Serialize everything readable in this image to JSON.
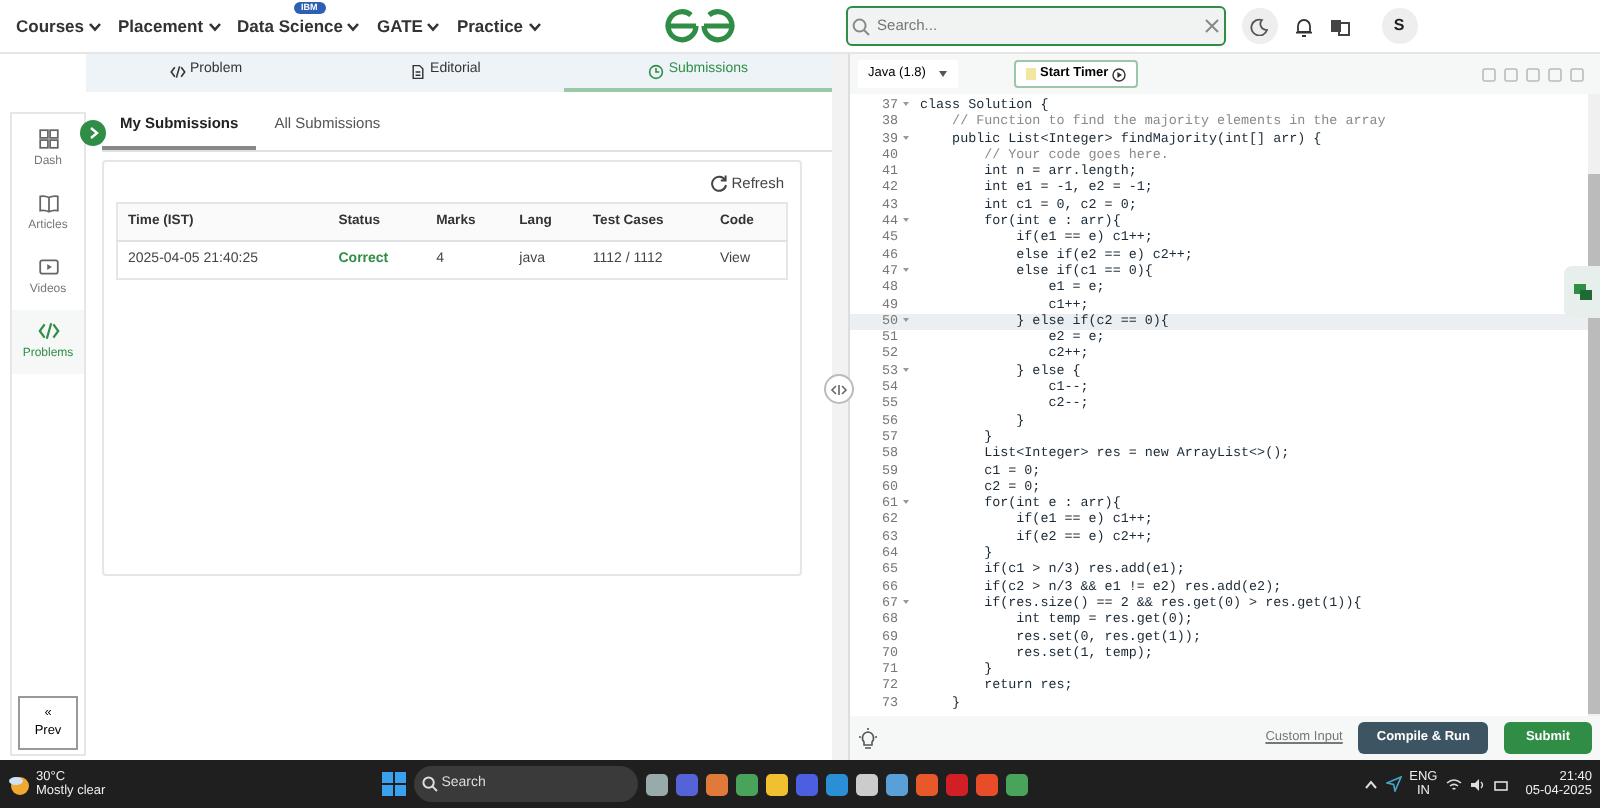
{
  "nav": {
    "menus": [
      {
        "label": "Courses"
      },
      {
        "label": "Placement"
      },
      {
        "label": "Data Science",
        "badge": "IBM"
      },
      {
        "label": "GATE"
      },
      {
        "label": "Practice"
      }
    ],
    "search": {
      "placeholder": "Search..."
    },
    "avatar": "S"
  },
  "problem_tabs": [
    {
      "label": "Problem",
      "selected": false
    },
    {
      "label": "Editorial",
      "selected": false
    },
    {
      "label": "Submissions",
      "selected": true
    }
  ],
  "sidebar": {
    "items": [
      {
        "label": "Dash",
        "selected": false
      },
      {
        "label": "Articles",
        "selected": false
      },
      {
        "label": "Videos",
        "selected": false
      },
      {
        "label": "Problems",
        "selected": true
      }
    ],
    "prev": "« Prev"
  },
  "submission_tabs": [
    {
      "label": "My Submissions",
      "selected": true
    },
    {
      "label": "All Submissions",
      "selected": false
    }
  ],
  "refresh": "Refresh",
  "table": {
    "columns": [
      "Time (IST)",
      "Status",
      "Marks",
      "Lang",
      "Test Cases",
      "Code"
    ],
    "rows": [
      {
        "time": "2025-04-05 21:40:25",
        "status": "Correct",
        "marks": "4",
        "lang": "java",
        "test_cases": "1112 / 1112",
        "code": "View"
      }
    ]
  },
  "editor": {
    "language": "Java (1.8)",
    "timer": "Start Timer",
    "lines": [
      {
        "n": "37",
        "text": "class Solution {",
        "fold": true,
        "kind": "code",
        "active": false
      },
      {
        "n": "38",
        "text": "    // Function to find the majority elements in the array",
        "fold": false,
        "kind": "comment",
        "active": false
      },
      {
        "n": "39",
        "text": "    public List<Integer> findMajority(int[] arr) {",
        "fold": true,
        "kind": "code",
        "active": false
      },
      {
        "n": "40",
        "text": "        // Your code goes here.",
        "fold": false,
        "kind": "comment",
        "active": false
      },
      {
        "n": "41",
        "text": "        int n = arr.length;",
        "fold": false,
        "kind": "code",
        "active": false
      },
      {
        "n": "42",
        "text": "        int e1 = -1, e2 = -1;",
        "fold": false,
        "kind": "code",
        "active": false
      },
      {
        "n": "43",
        "text": "        int c1 = 0, c2 = 0;",
        "fold": false,
        "kind": "code",
        "active": false
      },
      {
        "n": "44",
        "text": "        for(int e : arr){",
        "fold": true,
        "kind": "code",
        "active": false
      },
      {
        "n": "45",
        "text": "            if(e1 == e) c1++;",
        "fold": false,
        "kind": "code",
        "active": false
      },
      {
        "n": "46",
        "text": "            else if(e2 == e) c2++;",
        "fold": false,
        "kind": "code",
        "active": false
      },
      {
        "n": "47",
        "text": "            else if(c1 == 0){",
        "fold": true,
        "kind": "code",
        "active": false
      },
      {
        "n": "48",
        "text": "                e1 = e;",
        "fold": false,
        "kind": "code",
        "active": false
      },
      {
        "n": "49",
        "text": "                c1++;",
        "fold": false,
        "kind": "code",
        "active": false
      },
      {
        "n": "50",
        "text": "            } else if(c2 == 0){",
        "fold": true,
        "kind": "code",
        "active": true
      },
      {
        "n": "51",
        "text": "                e2 = e;",
        "fold": false,
        "kind": "code",
        "active": false
      },
      {
        "n": "52",
        "text": "                c2++;",
        "fold": false,
        "kind": "code",
        "active": false
      },
      {
        "n": "53",
        "text": "            } else {",
        "fold": true,
        "kind": "code",
        "active": false
      },
      {
        "n": "54",
        "text": "                c1--;",
        "fold": false,
        "kind": "code",
        "active": false
      },
      {
        "n": "55",
        "text": "                c2--;",
        "fold": false,
        "kind": "code",
        "active": false
      },
      {
        "n": "56",
        "text": "            }",
        "fold": false,
        "kind": "code",
        "active": false
      },
      {
        "n": "57",
        "text": "        }",
        "fold": false,
        "kind": "code",
        "active": false
      },
      {
        "n": "58",
        "text": "        List<Integer> res = new ArrayList<>();",
        "fold": false,
        "kind": "code",
        "active": false
      },
      {
        "n": "59",
        "text": "        c1 = 0;",
        "fold": false,
        "kind": "code",
        "active": false
      },
      {
        "n": "60",
        "text": "        c2 = 0;",
        "fold": false,
        "kind": "code",
        "active": false
      },
      {
        "n": "61",
        "text": "        for(int e : arr){",
        "fold": true,
        "kind": "code",
        "active": false
      },
      {
        "n": "62",
        "text": "            if(e1 == e) c1++;",
        "fold": false,
        "kind": "code",
        "active": false
      },
      {
        "n": "63",
        "text": "            if(e2 == e) c2++;",
        "fold": false,
        "kind": "code",
        "active": false
      },
      {
        "n": "64",
        "text": "        }",
        "fold": false,
        "kind": "code",
        "active": false
      },
      {
        "n": "65",
        "text": "        if(c1 > n/3) res.add(e1);",
        "fold": false,
        "kind": "code",
        "active": false
      },
      {
        "n": "66",
        "text": "        if(c2 > n/3 && e1 != e2) res.add(e2);",
        "fold": false,
        "kind": "code",
        "active": false
      },
      {
        "n": "67",
        "text": "        if(res.size() == 2 && res.get(0) > res.get(1)){",
        "fold": true,
        "kind": "code",
        "active": false
      },
      {
        "n": "68",
        "text": "            int temp = res.get(0);",
        "fold": false,
        "kind": "code",
        "active": false
      },
      {
        "n": "69",
        "text": "            res.set(0, res.get(1));",
        "fold": false,
        "kind": "code",
        "active": false
      },
      {
        "n": "70",
        "text": "            res.set(1, temp);",
        "fold": false,
        "kind": "code",
        "active": false
      },
      {
        "n": "71",
        "text": "        }",
        "fold": false,
        "kind": "code",
        "active": false
      },
      {
        "n": "72",
        "text": "        return res;",
        "fold": false,
        "kind": "code",
        "active": false
      },
      {
        "n": "73",
        "text": "    }",
        "fold": false,
        "kind": "code",
        "active": false
      }
    ],
    "custom_input": "Custom Input",
    "compile": "Compile & Run",
    "submit": "Submit"
  },
  "taskbar": {
    "temperature": "30°C",
    "weather": "Mostly clear",
    "search": "Search",
    "lang": "ENG",
    "region": "IN",
    "time": "21:40",
    "date": "05-04-2025"
  }
}
